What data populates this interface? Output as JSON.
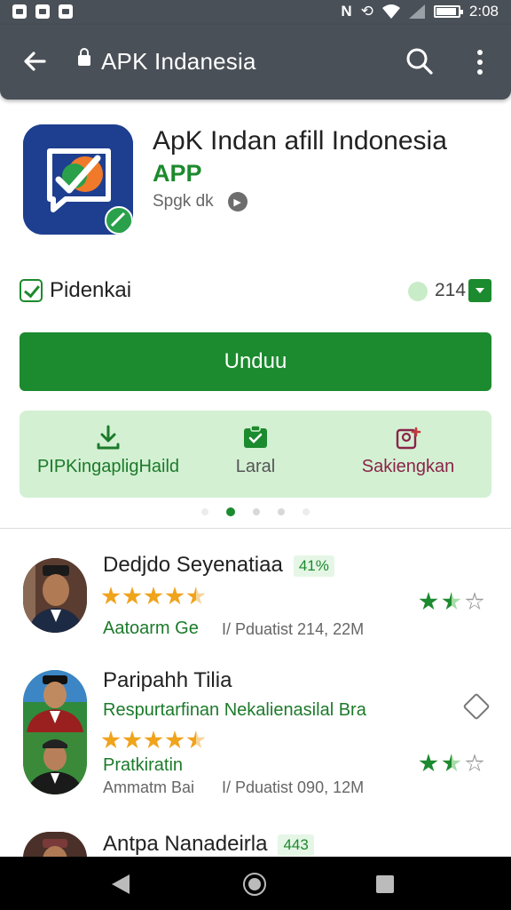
{
  "status_bar": {
    "time": "2:08"
  },
  "toolbar": {
    "title": "APK Indanesia"
  },
  "app": {
    "title": "ApK Indan afill Indonesia",
    "subtitle": "APP",
    "developer": "Spgk dk"
  },
  "rating_row": {
    "label": "Pidenkai",
    "count": "214"
  },
  "download": {
    "label": "Unduu"
  },
  "actions": [
    {
      "label": "PIPKingapligHaild",
      "icon": "download-icon"
    },
    {
      "label": "Laral",
      "icon": "clipboard-check-icon"
    },
    {
      "label": "Sakiengkan",
      "icon": "calendar-add-icon"
    }
  ],
  "carousel": {
    "pages": 5,
    "active": 2
  },
  "list": [
    {
      "name": "Dedjdo Seyenatiaa",
      "badge": "41%",
      "rating": 4.5,
      "line1_green": "Aatoarm Ge",
      "line1_gray": "I/ Pduatist 214, 22M",
      "mini_rating": 1.5
    },
    {
      "name": "Paripahh Tilia",
      "line_green": "Respurtarfinan Nekalienasilal Bra",
      "rating": 4.5,
      "line2_green": "Pratkiratin",
      "line2_gray": "Ammatm Bai",
      "line2_gray2": "I/ Pduatist 090, 12M",
      "mini_rating": 1.5
    },
    {
      "name": "Antpa Nanadeirla",
      "badge": "443"
    }
  ],
  "colors": {
    "toolbar_bg": "#4a5058",
    "brand_green": "#1c8a2e",
    "action_bg": "#d3f0d3",
    "star_orange": "#f0a31c"
  }
}
